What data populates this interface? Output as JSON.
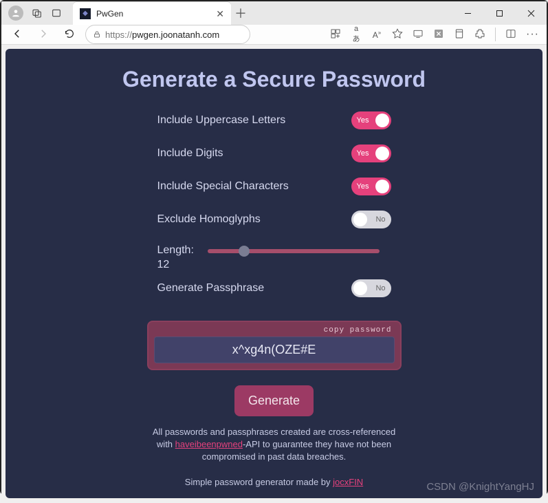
{
  "browser": {
    "tab_title": "PwGen",
    "url_scheme": "https://",
    "url_host": "pwgen.joonatanh.com"
  },
  "app": {
    "title": "Generate a Secure Password",
    "options": {
      "uppercase": {
        "label": "Include Uppercase Letters",
        "state": "Yes",
        "on": true
      },
      "digits": {
        "label": "Include Digits",
        "state": "Yes",
        "on": true
      },
      "special": {
        "label": "Include Special Characters",
        "state": "Yes",
        "on": true
      },
      "homoglyphs": {
        "label": "Exclude Homoglyphs",
        "state": "No",
        "on": false
      },
      "length": {
        "label": "Length:",
        "value": "12"
      },
      "passphrase": {
        "label": "Generate Passphrase",
        "state": "No",
        "on": false
      }
    },
    "copy_label": "copy password",
    "password": "x^xg4n(OZE#E",
    "generate_btn": "Generate",
    "note_pre": "All passwords and passphrases created are cross-referenced with ",
    "note_link": "haveibeenpwned",
    "note_post": "-API to guarantee they have not been compromised in past data breaches.",
    "footer_pre": "Simple password generator made by ",
    "footer_link": "jocxFIN"
  },
  "watermark": "CSDN @KnightYangHJ"
}
